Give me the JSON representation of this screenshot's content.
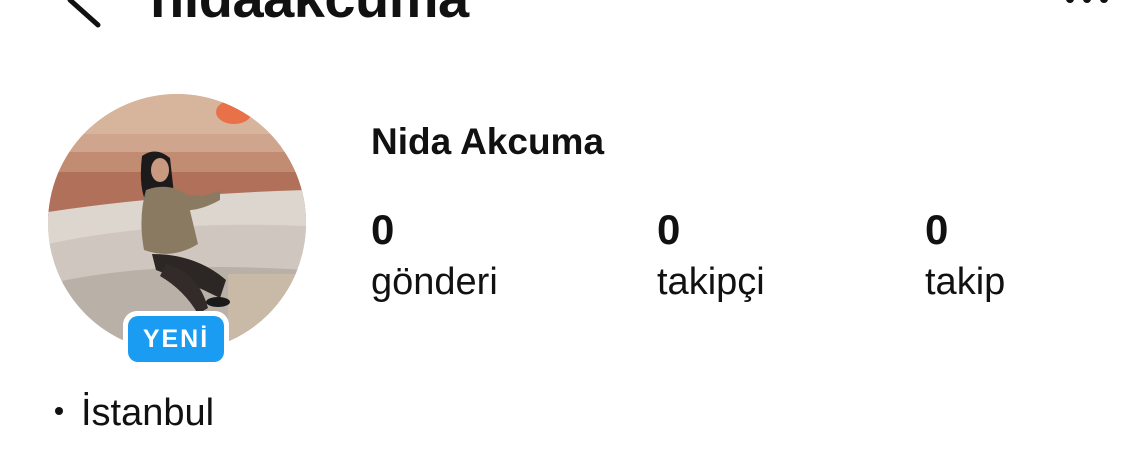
{
  "header": {
    "username": "nidaakcuma",
    "back_icon": "chevron-left-icon",
    "more_icon": "more-horizontal-icon"
  },
  "profile": {
    "display_name": "Nida Akcuma",
    "badge": "YENİ",
    "badge_color": "#1a9cf2",
    "stats": [
      {
        "value": "0",
        "label": "gönderi"
      },
      {
        "value": "0",
        "label": "takipçi"
      },
      {
        "value": "0",
        "label": "takip"
      }
    ],
    "location": "İstanbul"
  }
}
